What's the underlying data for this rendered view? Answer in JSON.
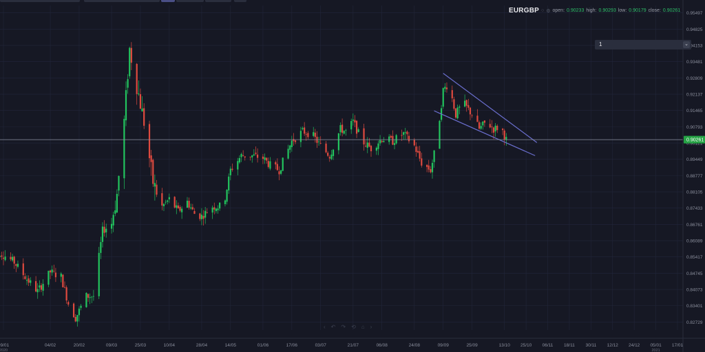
{
  "legend": {
    "symbol": "EURGBP",
    "open_label": "open:",
    "open": "0.90233",
    "high_label": "high:",
    "high": "0.90293",
    "low_label": "low:",
    "low": "0.90179",
    "close_label": "close:",
    "close": "0.90261"
  },
  "interval_select": {
    "value": "1"
  },
  "colors": {
    "background": "#161824",
    "up": "#22c55e",
    "down": "#e04a3f",
    "trendline": "#6b6fcf",
    "price_line": "#8d93a3",
    "price_badge": "#25a244"
  },
  "chart_data": {
    "type": "candlestick",
    "title": "",
    "yaxis_ticks": [
      "0.95497",
      "0.94825",
      "0.94153",
      "0.93481",
      "0.92809",
      "0.92137",
      "0.91465",
      "0.90793",
      "0.90121",
      "0.89449",
      "0.88777",
      "0.88105",
      "0.87433",
      "0.86761",
      "0.86089",
      "0.85417",
      "0.84745",
      "0.84073",
      "0.83401",
      "0.82729"
    ],
    "xaxis_ticks": [
      "09/01",
      "04/02",
      "20/02",
      "09/03",
      "25/03",
      "10/04",
      "28/04",
      "14/05",
      "01/06",
      "17/06",
      "03/07",
      "21/07",
      "06/08",
      "24/08",
      "09/09",
      "25/09",
      "13/10",
      "25/10",
      "06/11",
      "18/11",
      "30/11",
      "12/12",
      "24/12",
      "05/01",
      "17/01"
    ],
    "year_labels": [
      {
        "at": "09/01",
        "text": "2020"
      },
      {
        "at": "05/01",
        "text": "2021"
      }
    ],
    "last_price": "0.90261",
    "ylim": [
      0.824,
      0.958
    ],
    "trendlines": [
      {
        "x1": "09/09",
        "y1": 0.93,
        "x2": "31/10",
        "y2": 0.9014
      },
      {
        "x1": "04/09",
        "y1": 0.9145,
        "x2": "30/10",
        "y2": 0.896
      }
    ],
    "close_path": [
      {
        "d": "02/01",
        "v": 0.847
      },
      {
        "d": "07/01",
        "v": 0.856
      },
      {
        "d": "15/01",
        "v": 0.852
      },
      {
        "d": "22/01",
        "v": 0.845
      },
      {
        "d": "28/01",
        "v": 0.84
      },
      {
        "d": "04/02",
        "v": 0.848
      },
      {
        "d": "10/02",
        "v": 0.846
      },
      {
        "d": "14/02",
        "v": 0.835
      },
      {
        "d": "18/02",
        "v": 0.829
      },
      {
        "d": "24/02",
        "v": 0.838
      },
      {
        "d": "28/02",
        "v": 0.838
      },
      {
        "d": "04/03",
        "v": 0.865
      },
      {
        "d": "09/03",
        "v": 0.868
      },
      {
        "d": "12/03",
        "v": 0.88
      },
      {
        "d": "16/03",
        "v": 0.91
      },
      {
        "d": "19/03",
        "v": 0.94
      },
      {
        "d": "23/03",
        "v": 0.925
      },
      {
        "d": "27/03",
        "v": 0.91
      },
      {
        "d": "01/04",
        "v": 0.885
      },
      {
        "d": "06/04",
        "v": 0.875
      },
      {
        "d": "10/04",
        "v": 0.878
      },
      {
        "d": "15/04",
        "v": 0.873
      },
      {
        "d": "20/04",
        "v": 0.877
      },
      {
        "d": "24/04",
        "v": 0.872
      },
      {
        "d": "28/04",
        "v": 0.871
      },
      {
        "d": "04/05",
        "v": 0.875
      },
      {
        "d": "10/05",
        "v": 0.875
      },
      {
        "d": "14/05",
        "v": 0.89
      },
      {
        "d": "20/05",
        "v": 0.896
      },
      {
        "d": "26/05",
        "v": 0.896
      },
      {
        "d": "01/06",
        "v": 0.895
      },
      {
        "d": "05/06",
        "v": 0.892
      },
      {
        "d": "10/06",
        "v": 0.89
      },
      {
        "d": "17/06",
        "v": 0.902
      },
      {
        "d": "23/06",
        "v": 0.906
      },
      {
        "d": "28/06",
        "v": 0.905
      },
      {
        "d": "03/07",
        "v": 0.9
      },
      {
        "d": "08/07",
        "v": 0.896
      },
      {
        "d": "14/07",
        "v": 0.907
      },
      {
        "d": "17/07",
        "v": 0.906
      },
      {
        "d": "21/07",
        "v": 0.91
      },
      {
        "d": "26/07",
        "v": 0.902
      },
      {
        "d": "31/07",
        "v": 0.899
      },
      {
        "d": "06/08",
        "v": 0.903
      },
      {
        "d": "12/08",
        "v": 0.902
      },
      {
        "d": "18/08",
        "v": 0.905
      },
      {
        "d": "24/08",
        "v": 0.9
      },
      {
        "d": "28/08",
        "v": 0.893
      },
      {
        "d": "02/09",
        "v": 0.89
      },
      {
        "d": "05/09",
        "v": 0.9
      },
      {
        "d": "09/09",
        "v": 0.923
      },
      {
        "d": "12/09",
        "v": 0.926
      },
      {
        "d": "16/09",
        "v": 0.913
      },
      {
        "d": "20/09",
        "v": 0.918
      },
      {
        "d": "25/09",
        "v": 0.913
      },
      {
        "d": "29/09",
        "v": 0.907
      },
      {
        "d": "03/10",
        "v": 0.91
      },
      {
        "d": "07/10",
        "v": 0.907
      },
      {
        "d": "11/10",
        "v": 0.908
      },
      {
        "d": "14/10",
        "v": 0.9026
      }
    ]
  }
}
